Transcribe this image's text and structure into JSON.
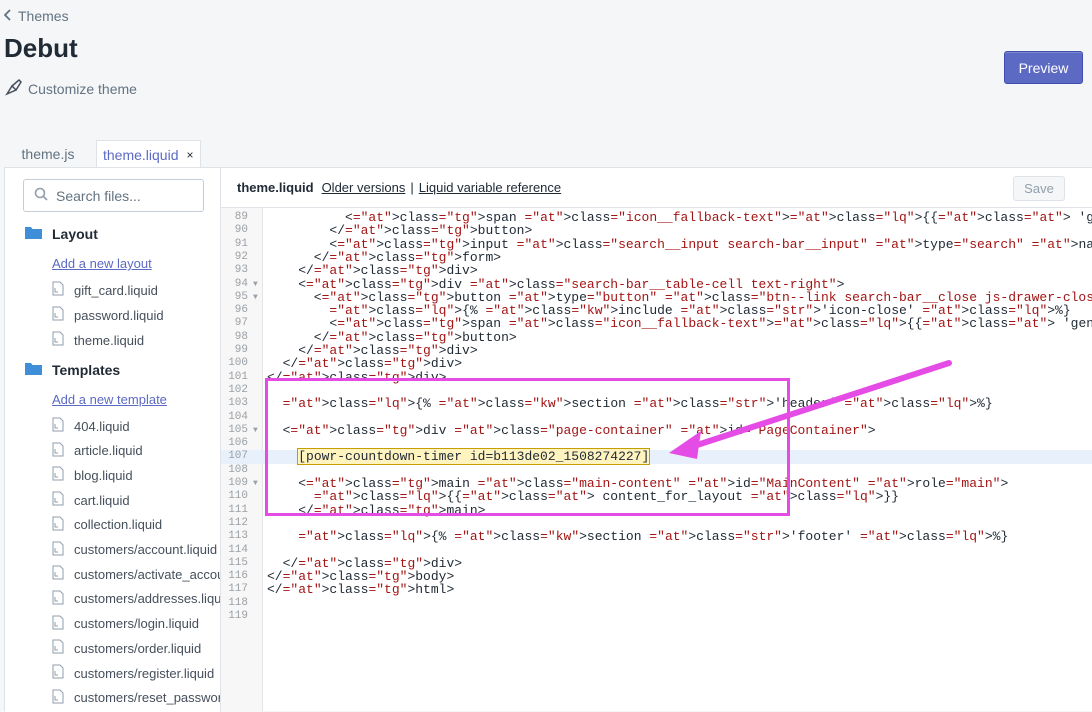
{
  "header": {
    "back_label": "Themes",
    "title": "Debut",
    "customize_label": "Customize theme",
    "preview_label": "Preview"
  },
  "tabs": [
    {
      "label": "theme.js"
    },
    {
      "label": "theme.liquid",
      "close": "×"
    }
  ],
  "sidebar": {
    "search_placeholder": "Search files...",
    "layout": {
      "label": "Layout",
      "add_label": "Add a new layout",
      "files": [
        "gift_card.liquid",
        "password.liquid",
        "theme.liquid"
      ]
    },
    "templates": {
      "label": "Templates",
      "add_label": "Add a new template",
      "files": [
        "404.liquid",
        "article.liquid",
        "blog.liquid",
        "cart.liquid",
        "collection.liquid",
        "customers/account.liquid",
        "customers/activate_account.liquid",
        "customers/addresses.liquid",
        "customers/login.liquid",
        "customers/order.liquid",
        "customers/register.liquid",
        "customers/reset_password.liquid"
      ]
    }
  },
  "code_header": {
    "filename": "theme.liquid",
    "older_versions": "Older versions",
    "separator": "|",
    "liquid_ref": "Liquid variable reference",
    "save_label": "Save"
  },
  "code_lines": [
    {
      "n": "89",
      "fold": "",
      "html": "          <span class=\"icon__fallback-text\">{{ 'general.search.submit' | t }}</span>"
    },
    {
      "n": "90",
      "fold": "",
      "html": "        </button>"
    },
    {
      "n": "91",
      "fold": "",
      "html": "        <input class=\"search__input search-bar__input\" type=\"search\" name=\"q\" value=\"{{ search.terms"
    },
    {
      "n": "92",
      "fold": "",
      "html": "      </form>"
    },
    {
      "n": "93",
      "fold": "",
      "html": "    </div>"
    },
    {
      "n": "94",
      "fold": "▼",
      "html": "    <div class=\"search-bar__table-cell text-right\">"
    },
    {
      "n": "95",
      "fold": "▼",
      "html": "      <button type=\"button\" class=\"btn--link search-bar__close js-drawer-close\">"
    },
    {
      "n": "96",
      "fold": "",
      "html": "        {% include 'icon-close' %}"
    },
    {
      "n": "97",
      "fold": "",
      "html": "        <span class=\"icon__fallback-text\">{{ 'general.search.close' | t }}</span>"
    },
    {
      "n": "98",
      "fold": "",
      "html": "      </button>"
    },
    {
      "n": "99",
      "fold": "",
      "html": "    </div>"
    },
    {
      "n": "100",
      "fold": "",
      "html": "  </div>"
    },
    {
      "n": "101",
      "fold": "",
      "html": "</div>"
    },
    {
      "n": "102",
      "fold": "",
      "html": ""
    },
    {
      "n": "103",
      "fold": "",
      "html": "  {% section 'header' %}"
    },
    {
      "n": "104",
      "fold": "",
      "html": ""
    },
    {
      "n": "105",
      "fold": "▼",
      "html": "  <div class=\"page-container\" id=\"PageContainer\">"
    },
    {
      "n": "106",
      "fold": "",
      "html": ""
    },
    {
      "n": "107",
      "fold": "",
      "html": "    [powr-countdown-timer id=b113de02_1508274227]"
    },
    {
      "n": "108",
      "fold": "",
      "html": ""
    },
    {
      "n": "109",
      "fold": "▼",
      "html": "    <main class=\"main-content\" id=\"MainContent\" role=\"main\">"
    },
    {
      "n": "110",
      "fold": "",
      "html": "      {{ content_for_layout }}"
    },
    {
      "n": "111",
      "fold": "",
      "html": "    </main>"
    },
    {
      "n": "112",
      "fold": "",
      "html": ""
    },
    {
      "n": "113",
      "fold": "",
      "html": "    {% section 'footer' %}"
    },
    {
      "n": "114",
      "fold": "",
      "html": ""
    },
    {
      "n": "115",
      "fold": "",
      "html": "  </div>"
    },
    {
      "n": "116",
      "fold": "",
      "html": "</body>"
    },
    {
      "n": "117",
      "fold": "",
      "html": "</html>"
    },
    {
      "n": "118",
      "fold": "",
      "html": ""
    },
    {
      "n": "119",
      "fold": "",
      "html": ""
    }
  ],
  "colors": {
    "accent": "#5c6ac4",
    "annotation": "#e54ce5"
  }
}
